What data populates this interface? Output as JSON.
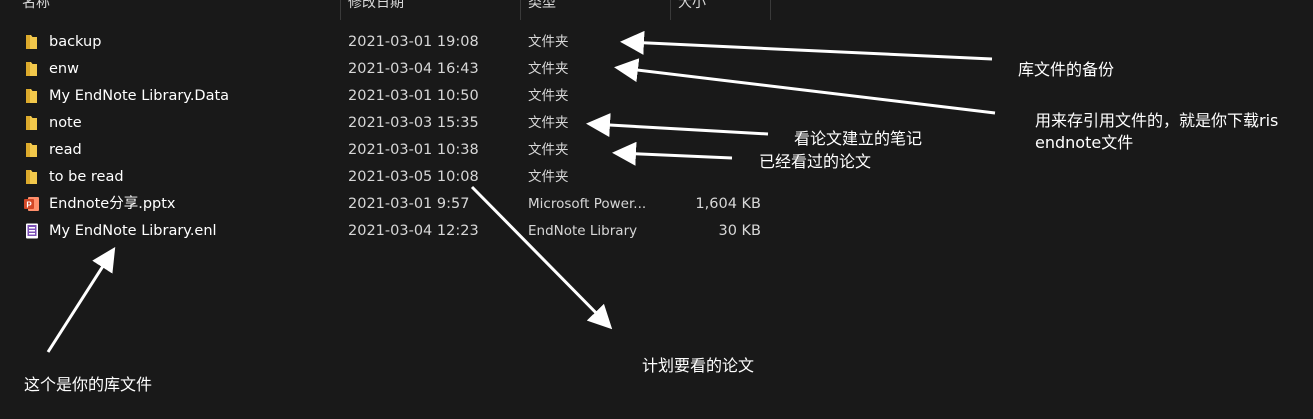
{
  "header": {
    "name_label": "名称",
    "date_label": "修改日期",
    "type_label": "类型",
    "size_label": "大小"
  },
  "files": [
    {
      "name": "backup",
      "date": "2021-03-01 19:08",
      "type": "文件夹",
      "size": "",
      "icon": "folder-icon"
    },
    {
      "name": "enw",
      "date": "2021-03-04 16:43",
      "type": "文件夹",
      "size": "",
      "icon": "folder-icon"
    },
    {
      "name": "My EndNote Library.Data",
      "date": "2021-03-01 10:50",
      "type": "文件夹",
      "size": "",
      "icon": "folder-icon"
    },
    {
      "name": "note",
      "date": "2021-03-03 15:35",
      "type": "文件夹",
      "size": "",
      "icon": "folder-icon"
    },
    {
      "name": "read",
      "date": "2021-03-01 10:38",
      "type": "文件夹",
      "size": "",
      "icon": "folder-icon"
    },
    {
      "name": "to be read",
      "date": "2021-03-05 10:08",
      "type": "文件夹",
      "size": "",
      "icon": "folder-icon"
    },
    {
      "name": "Endnote分享.pptx",
      "date": "2021-03-01 9:57",
      "type": "Microsoft Power...",
      "size": "1,604 KB",
      "icon": "powerpoint-icon"
    },
    {
      "name": "My EndNote Library.enl",
      "date": "2021-03-04 12:23",
      "type": "EndNote Library",
      "size": "30 KB",
      "icon": "endnote-library-icon"
    }
  ],
  "annotations": {
    "backup_note": "库文件的备份",
    "enw_note": "用来存引用文件的，就是你下载ris endnote文件",
    "note_note": "看论文建立的笔记",
    "read_note": "已经看过的论文",
    "to_be_read_note": "计划要看的论文",
    "library_note": "这个是你的库文件"
  },
  "colors": {
    "background": "#191919",
    "folder": "#f2c84b",
    "powerpoint": "#d24726",
    "endnote": "#7b4fb5",
    "text": "#ffffff"
  }
}
